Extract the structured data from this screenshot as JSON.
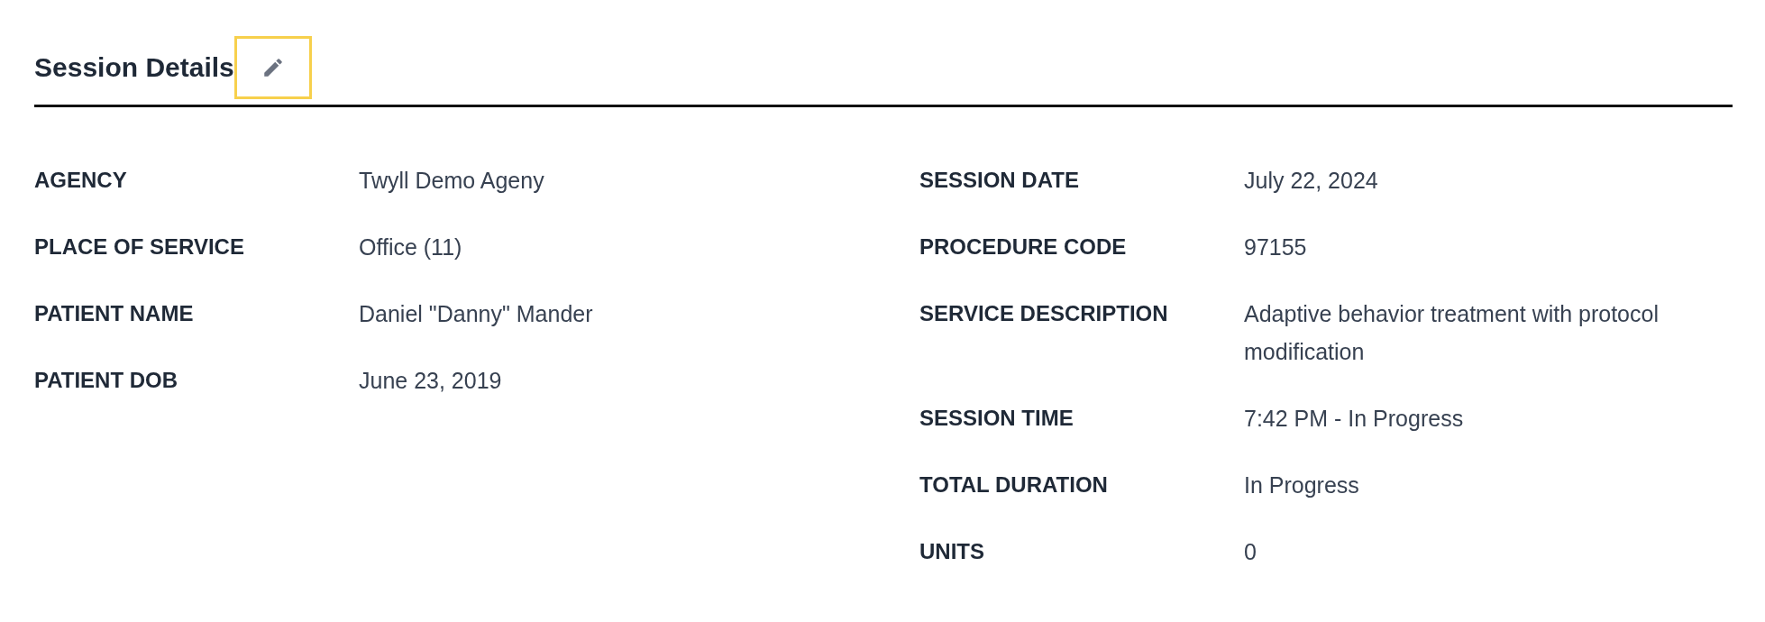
{
  "section": {
    "title": "Session Details"
  },
  "left_fields": [
    {
      "label": "AGENCY",
      "value": "Twyll Demo Ageny"
    },
    {
      "label": "PLACE OF SERVICE",
      "value": "Office (11)"
    },
    {
      "label": "PATIENT NAME",
      "value": "Daniel \"Danny\" Mander"
    },
    {
      "label": "PATIENT DOB",
      "value": "June 23, 2019"
    }
  ],
  "right_fields": [
    {
      "label": "SESSION DATE",
      "value": "July 22, 2024"
    },
    {
      "label": "PROCEDURE CODE",
      "value": "97155"
    },
    {
      "label": "SERVICE DESCRIPTION",
      "value": "Adaptive behavior treatment with protocol modification"
    },
    {
      "label": "SESSION TIME",
      "value": "7:42 PM - In Progress"
    },
    {
      "label": "TOTAL DURATION",
      "value": "In Progress"
    },
    {
      "label": "UNITS",
      "value": "0"
    }
  ]
}
